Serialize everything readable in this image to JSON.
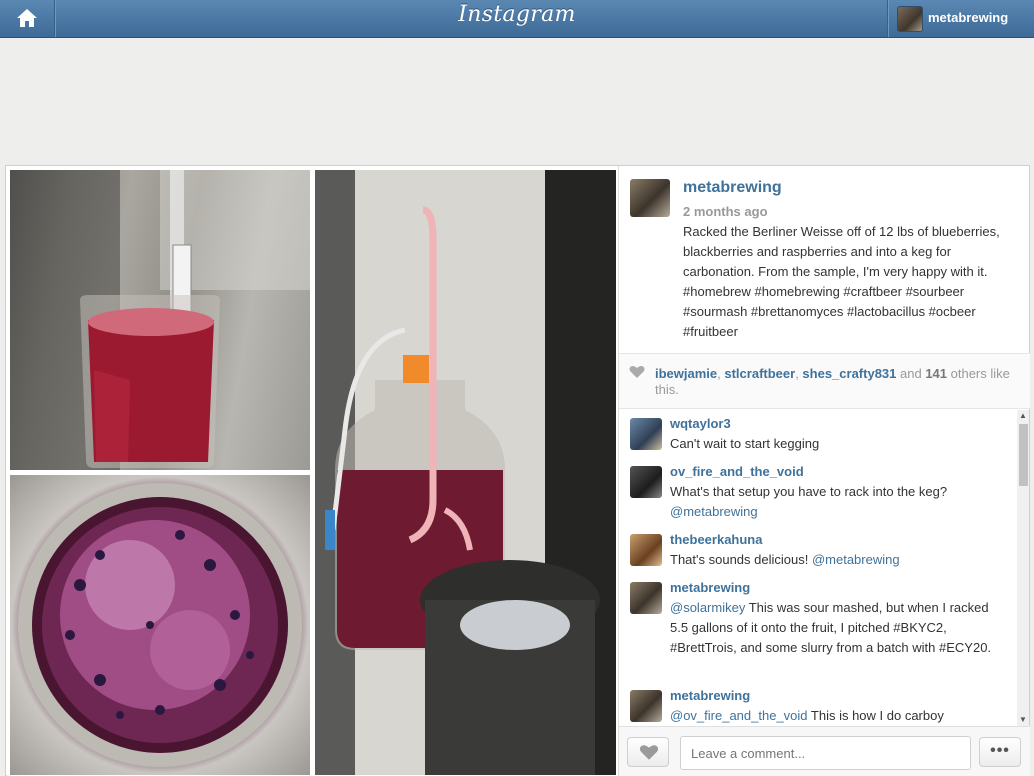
{
  "header": {
    "logo": "Instagram",
    "username": "metabrewing"
  },
  "post": {
    "username": "metabrewing",
    "time": "2 months ago",
    "caption": "Racked the Berliner Weisse off of 12 lbs of blueberries, blackberries and raspberries and into a keg for carbonation. From the sample, I'm very happy with it. #homebrew #homebrewing #craftbeer #sourbeer #sourmash #brettanomyces #lactobacillus #ocbeer #fruitbeer"
  },
  "likes": {
    "user1": "ibewjamie",
    "sep1": ", ",
    "user2": "stlcraftbeer",
    "sep2": ", ",
    "user3": "shes_crafty831",
    "and": " and ",
    "count": "141",
    "others": " others like this."
  },
  "comments": [
    {
      "user": "wqtaylor3",
      "text": "Can't wait to start kegging",
      "mention": ""
    },
    {
      "user": "ov_fire_and_the_void",
      "text": "What's that setup you have to rack into the keg?",
      "mention": "@metabrewing"
    },
    {
      "user": "thebeerkahuna",
      "text": "That's sounds delicious! ",
      "mention": "@metabrewing"
    },
    {
      "user": "metabrewing",
      "mention": "@solarmikey",
      "text": " This was sour mashed, but when I racked 5.5 gallons of it onto the fruit, I pitched #BKYC2, #BrettTrois, and some slurry from a batch with #ECY20."
    },
    {
      "user": "metabrewing",
      "mention": "@ov_fire_and_the_void",
      "text": " This is how I do carboy"
    }
  ],
  "footer": {
    "comment_placeholder": "Leave a comment...",
    "more_label": "•••"
  },
  "colors": {
    "header_blue": "#3e6a97",
    "link_blue": "#3f729b"
  }
}
